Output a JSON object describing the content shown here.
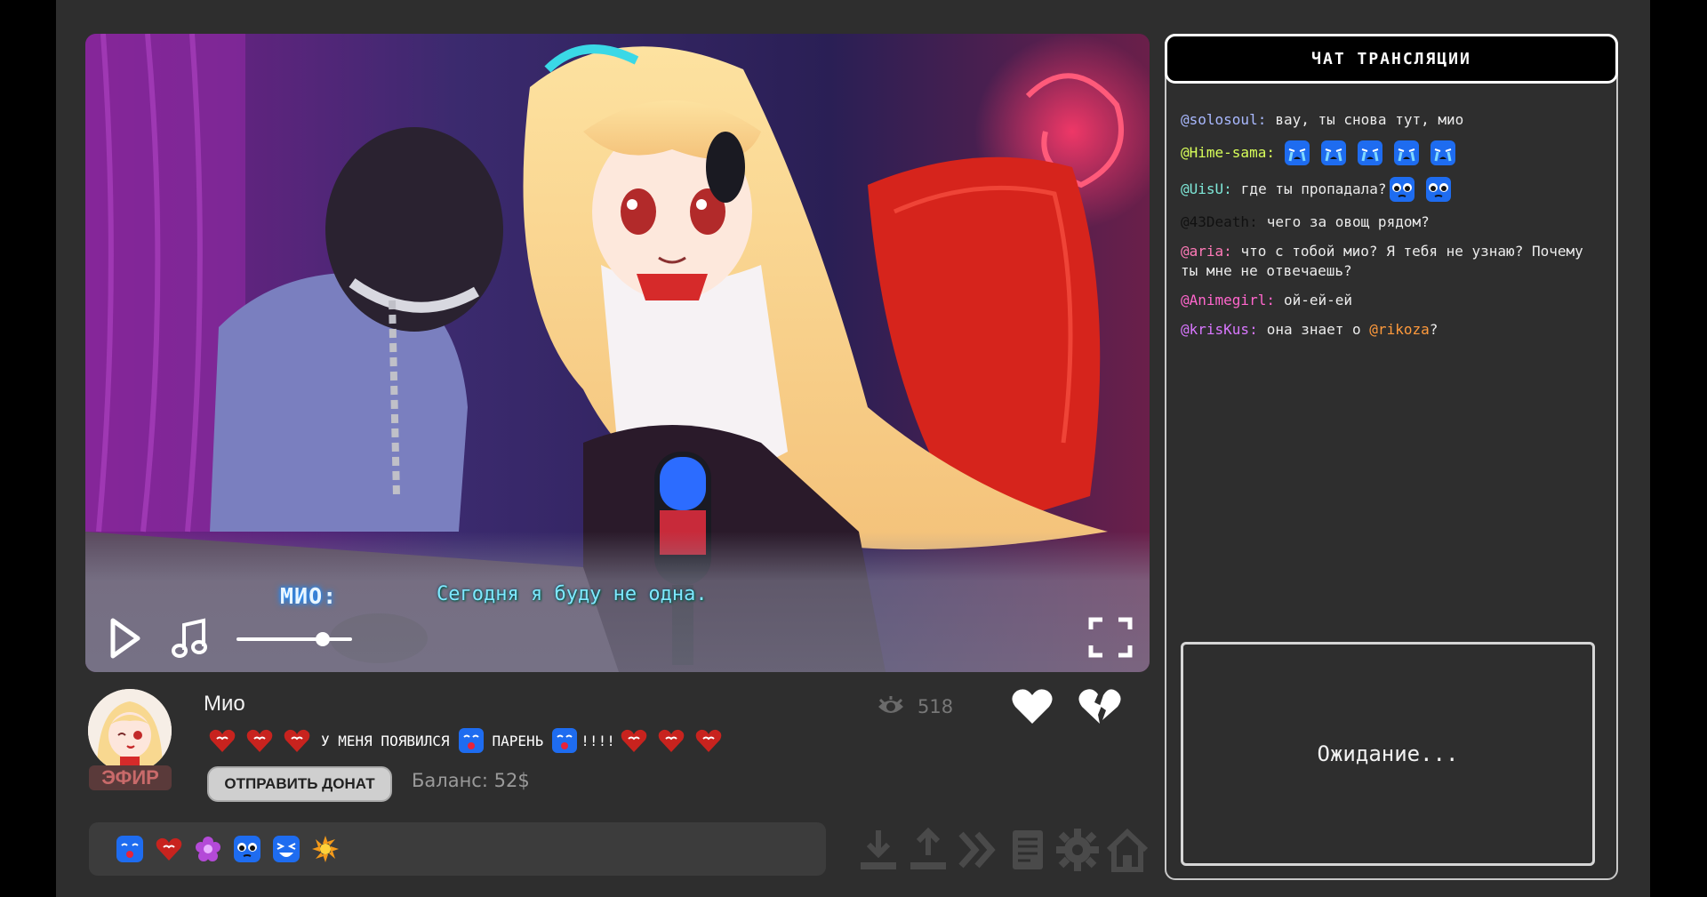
{
  "video": {
    "speaker": "МИО:",
    "subtitle": "Сегодня я буду не одна.",
    "volume": 0.78,
    "icons": {
      "play": "play-icon",
      "music": "music-note-icon",
      "fullscreen": "fullscreen-icon"
    }
  },
  "profile": {
    "name": "Мио",
    "live_badge": "ЭФИР",
    "status": {
      "word1": "У МЕНЯ ПОЯВИЛСЯ",
      "word2": "ПАРЕНЬ",
      "word3": "!!!!"
    },
    "donate_label": "ОТПРАВИТЬ ДОНАТ",
    "balance": "Баланс: 52$",
    "viewers": "518"
  },
  "chat": {
    "title": "ЧАТ ТРАНСЛЯЦИИ",
    "messages": [
      {
        "nick": "@solosoul:",
        "text": "вау, ты снова тут, мио",
        "color": "#a9b9ff"
      },
      {
        "nick": "@Hime-sama:",
        "text": "",
        "color": "#d8ff5a"
      },
      {
        "nick": "@UisU:",
        "text": "где ты пропадала?",
        "color": "#7fe9d9"
      },
      {
        "nick": "@43Death:",
        "text": "чего за овощ рядом?",
        "color": "#111111"
      },
      {
        "nick": "@aria:",
        "text": "что с тобой мио? Я тебя не узнаю? Почему ты мне не отвечаешь?",
        "color": "#ff7ab8"
      },
      {
        "nick": "@Animegirl:",
        "text": "ой-ей-ей",
        "color": "#ff66cc"
      },
      {
        "nick": "@krisKus:",
        "text": "она знает о ",
        "mention": "@rikoza",
        "tail": "?",
        "color": "#d977ff",
        "mention_color": "#ff9a3c"
      }
    ],
    "waiting": "Ожидание..."
  },
  "colors": {
    "accent_blue": "#1e6cf0",
    "heart_red": "#c8231e",
    "bg": "#2e2e2e"
  }
}
